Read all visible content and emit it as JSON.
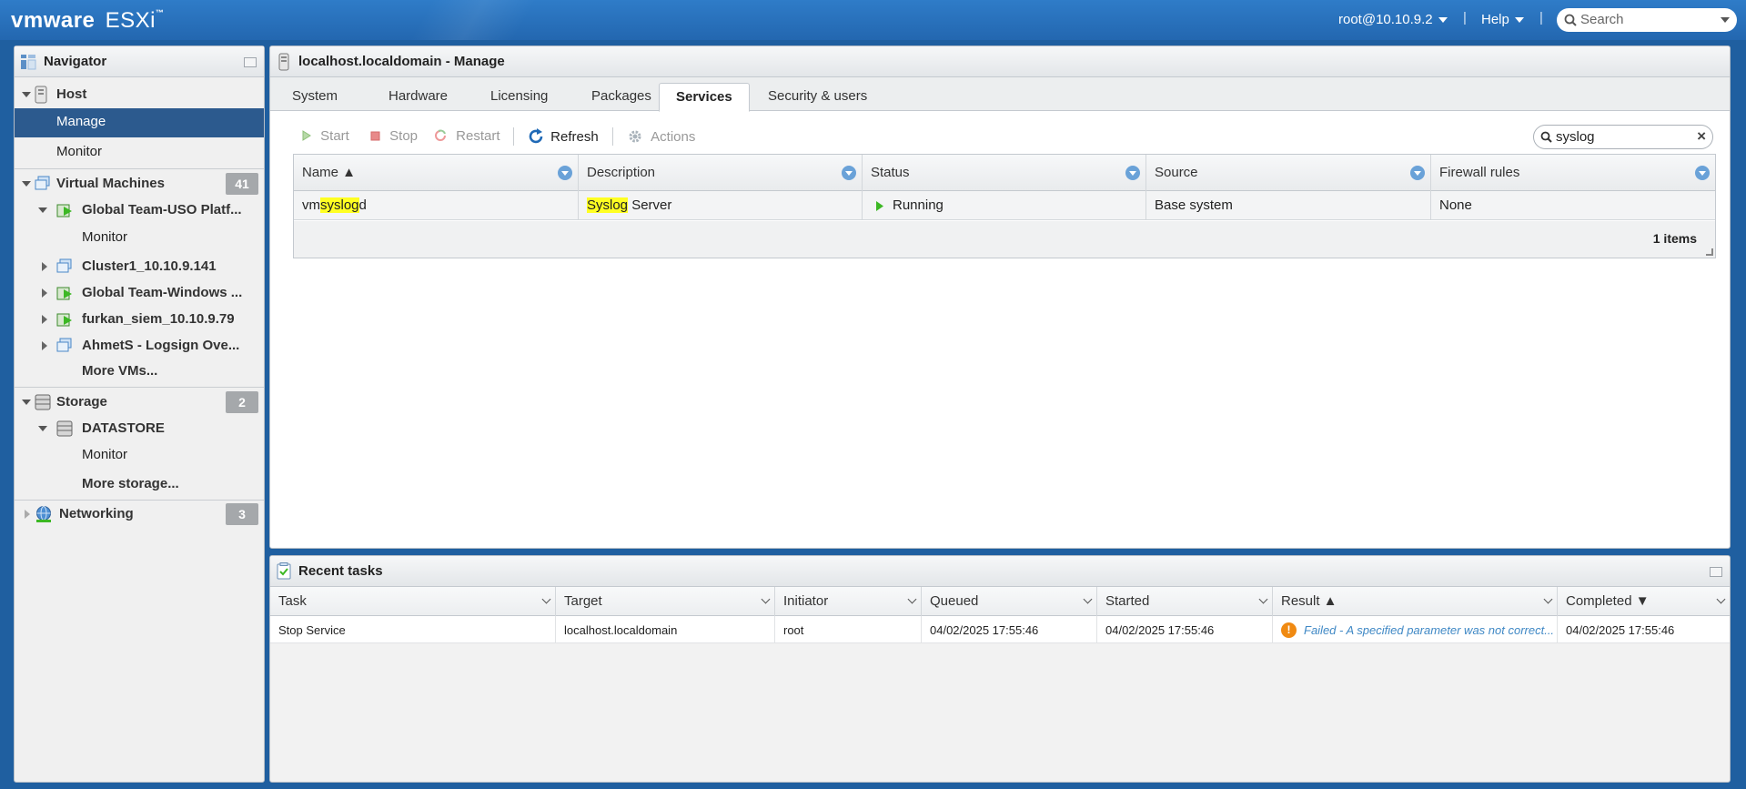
{
  "topbar": {
    "brand": "vm",
    "brand_bold": "ware",
    "product": "ESXi",
    "trademark": "™",
    "user": "root@10.10.9.2",
    "help": "Help",
    "separator": "|",
    "search_placeholder": "Search"
  },
  "navigator": {
    "title": "Navigator",
    "host": "Host",
    "host_manage": "Manage",
    "host_monitor": "Monitor",
    "vms": "Virtual Machines",
    "vms_count": "41",
    "vm_items": [
      {
        "label": "Global Team-USO Platf..."
      },
      {
        "label": "Monitor"
      },
      {
        "label": "Cluster1_10.10.9.141"
      },
      {
        "label": "Global Team-Windows ..."
      },
      {
        "label": "furkan_siem_10.10.9.79"
      },
      {
        "label": "AhmetS - Logsign Ove..."
      },
      {
        "label": "More VMs..."
      }
    ],
    "storage": "Storage",
    "storage_count": "2",
    "datastore": "DATASTORE",
    "datastore_monitor": "Monitor",
    "more_storage": "More storage...",
    "networking": "Networking",
    "networking_count": "3"
  },
  "main": {
    "title": "localhost.localdomain - Manage",
    "tabs": [
      {
        "label": "System"
      },
      {
        "label": "Hardware"
      },
      {
        "label": "Licensing"
      },
      {
        "label": "Packages"
      },
      {
        "label": "Services"
      },
      {
        "label": "Security & users"
      }
    ],
    "active_tab": "Services",
    "toolbar": {
      "start": "Start",
      "stop": "Stop",
      "restart": "Restart",
      "refresh": "Refresh",
      "actions": "Actions"
    },
    "filter_value": "syslog",
    "columns": [
      "Name ▲",
      "Description",
      "Status",
      "Source",
      "Firewall rules"
    ],
    "row": {
      "name_pre": "vm",
      "name_hl": "syslog",
      "name_post": "d",
      "desc_hl": "Syslog",
      "desc_post": " Server",
      "status": "Running",
      "source": "Base system",
      "firewall": "None"
    },
    "item_count": "1 items"
  },
  "tasks": {
    "title": "Recent tasks",
    "columns": [
      "Task",
      "Target",
      "Initiator",
      "Queued",
      "Started",
      "Result ▲",
      "Completed ▼"
    ],
    "row": {
      "task": "Stop Service",
      "target": "localhost.localdomain",
      "initiator": "root",
      "queued": "04/02/2025 17:55:46",
      "started": "04/02/2025 17:55:46",
      "result": "Failed - A specified parameter was not correct...",
      "completed": "04/02/2025 17:55:46"
    }
  },
  "colors": {
    "topbar": "#2367b0",
    "selected": "#2c5a8e",
    "highlight": "#ffff22",
    "running": "#3cb824",
    "warning": "#f08a12"
  }
}
